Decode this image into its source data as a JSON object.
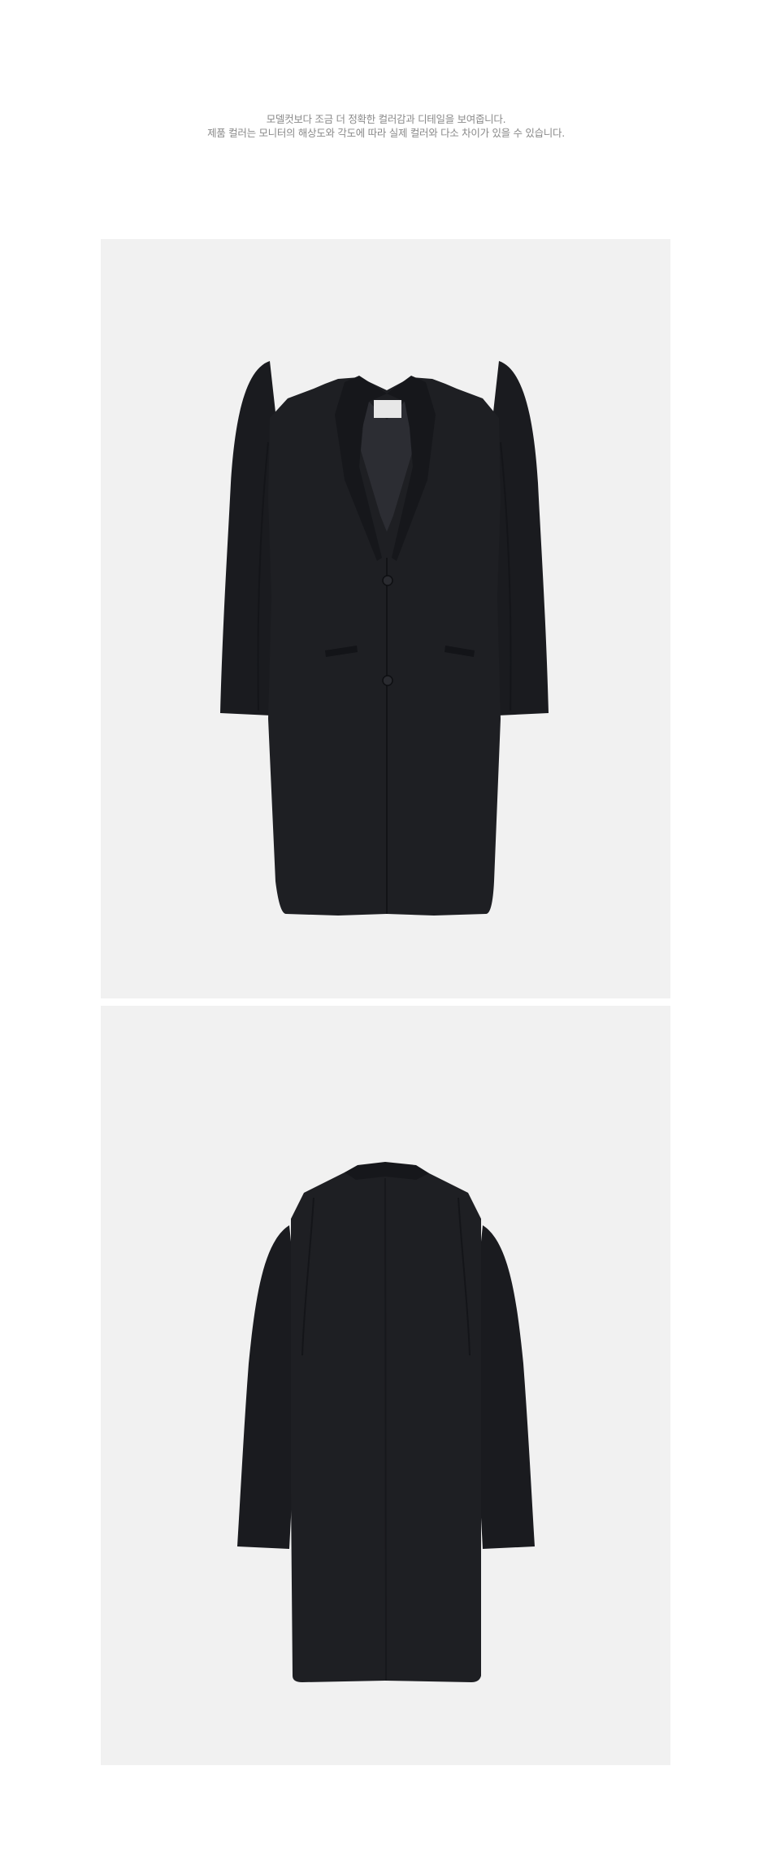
{
  "notice": {
    "line1": "모델컷보다 조금 더 정확한 컬러감과 디테일을 보여줍니다.",
    "line2": "제품 컬러는 모니터의 해상도와 각도에 따라 실제 컬러와 다소 차이가 있을 수 있습니다."
  },
  "colors": {
    "background": "#ffffff",
    "panel": "#f1f1f1",
    "garment": "#1c1d21",
    "notice_text": "#8a8a8a"
  },
  "photos": [
    {
      "view": "front",
      "subject": "black long coat"
    },
    {
      "view": "back",
      "subject": "black long coat"
    }
  ]
}
